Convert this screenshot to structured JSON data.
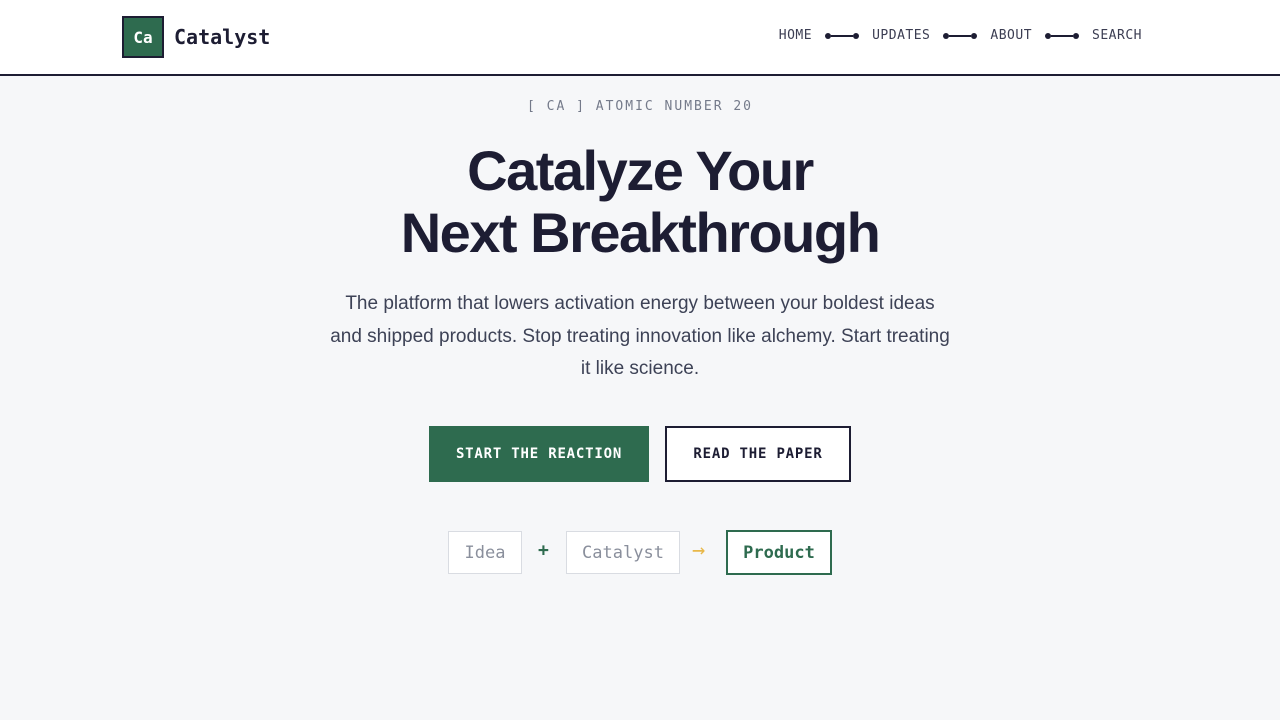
{
  "header": {
    "logo_symbol": "Ca",
    "logo_text": "Catalyst",
    "nav": [
      {
        "label": "HOME"
      },
      {
        "label": "UPDATES"
      },
      {
        "label": "ABOUT"
      },
      {
        "label": "SEARCH"
      }
    ]
  },
  "hero": {
    "eyebrow": "[ CA ] ATOMIC NUMBER 20",
    "headline_line1": "Catalyze Your",
    "headline_line2": "Next Breakthrough",
    "subtext": "The platform that lowers activation energy between your boldest ideas and shipped products. Stop treating innovation like alchemy. Start treating it like science.",
    "primary_button": "START THE REACTION",
    "secondary_button": "READ THE PAPER"
  },
  "equation": {
    "reactant_1": "Idea",
    "plus": "+",
    "reactant_2": "Catalyst",
    "arrow": "→",
    "result": "Product"
  },
  "colors": {
    "brand_green": "#2e6b4f",
    "ink": "#1d1d33",
    "accent_arrow": "#e8b84a",
    "background": "#f6f7f9"
  }
}
